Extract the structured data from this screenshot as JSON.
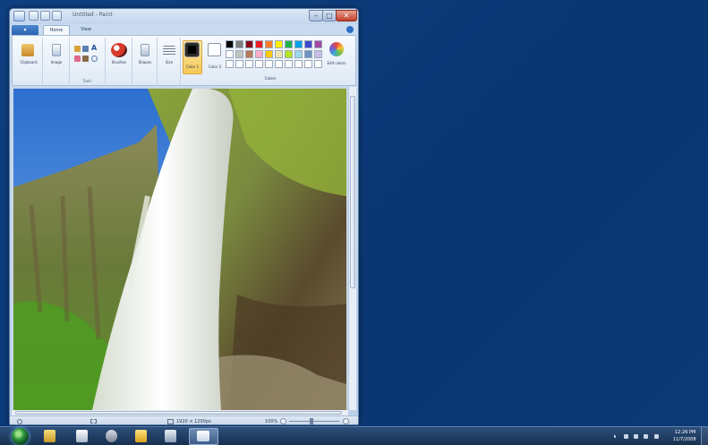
{
  "window": {
    "title": "Untitled - Paint",
    "minimize": "–",
    "maximize": "□",
    "close": "✕"
  },
  "ribbon": {
    "file_label": "",
    "tabs": [
      "Home",
      "View"
    ],
    "groups": {
      "clipboard": "Clipboard",
      "image": "Image",
      "tools": "Tools",
      "brushes": "Brushes",
      "shapes": "Shapes",
      "size": "Size",
      "color1": "Color 1",
      "color2": "Color 2",
      "colors_group": "Colors",
      "edit_colors": "Edit colors"
    },
    "palette_row1": [
      "#000000",
      "#7f7f7f",
      "#880015",
      "#ed1c24",
      "#ff7f27",
      "#fff200",
      "#22b14c",
      "#00a2e8",
      "#3f48cc",
      "#a349a4"
    ],
    "palette_row2": [
      "#ffffff",
      "#c3c3c3",
      "#b97a57",
      "#ffaec9",
      "#ffc90e",
      "#efe4b0",
      "#b5e61d",
      "#99d9ea",
      "#7092be",
      "#c8bfe7"
    ],
    "palette_row3": [
      "#ffffff",
      "#ffffff",
      "#ffffff",
      "#ffffff",
      "#ffffff",
      "#ffffff",
      "#ffffff",
      "#ffffff",
      "#ffffff",
      "#ffffff"
    ]
  },
  "canvas": {
    "image_subject": "waterfall landscape photo"
  },
  "status_bar": {
    "size": "1920 × 1200px",
    "zoom": "100%"
  },
  "taskbar": {
    "time": "12:26 PM",
    "date": "11/7/2008"
  }
}
